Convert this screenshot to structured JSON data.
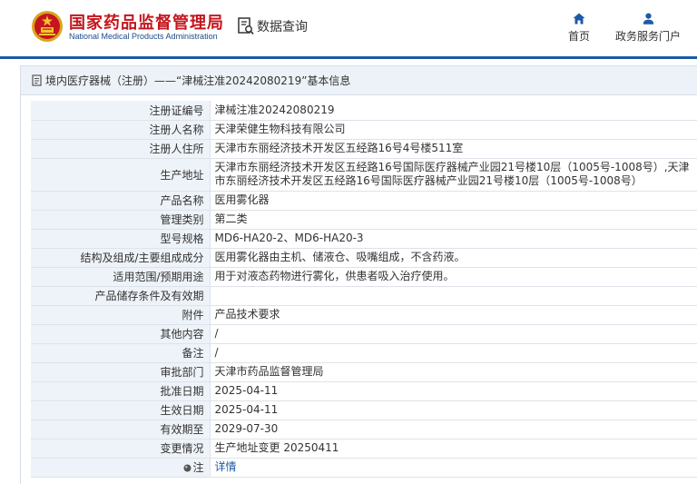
{
  "header": {
    "brand_cn": "国家药品监督管理局",
    "brand_en": "National Medical Products Administration",
    "query_label": "数据查询",
    "nav_home": "首页",
    "nav_service": "政务服务门户"
  },
  "colors": {
    "brand_red": "#c4161c",
    "brand_blue": "#1d5aa6",
    "label_bg": "#eef3f9"
  },
  "panel": {
    "title": "境内医疗器械（注册）——“津械注准20242080219”基本信息"
  },
  "rows": [
    {
      "label": "注册证编号",
      "value": "津械注准20242080219"
    },
    {
      "label": "注册人名称",
      "value": "天津荣健生物科技有限公司"
    },
    {
      "label": "注册人住所",
      "value": "天津市东丽经济技术开发区五经路16号4号楼511室"
    },
    {
      "label": "生产地址",
      "value": "天津市东丽经济技术开发区五经路16号国际医疗器械产业园21号楼10层（1005号-1008号）,天津市东丽经济技术开发区五经路16号国际医疗器械产业园21号楼10层（1005号-1008号）"
    },
    {
      "label": "产品名称",
      "value": "医用雾化器"
    },
    {
      "label": "管理类别",
      "value": "第二类"
    },
    {
      "label": "型号规格",
      "value": "MD6-HA20-2、MD6-HA20-3"
    },
    {
      "label": "结构及组成/主要组成成分",
      "value": "医用雾化器由主机、储液仓、吸嘴组成，不含药液。"
    },
    {
      "label": "适用范围/预期用途",
      "value": "用于对液态药物进行雾化，供患者吸入治疗使用。"
    },
    {
      "label": "产品储存条件及有效期",
      "value": ""
    },
    {
      "label": "附件",
      "value": "产品技术要求"
    },
    {
      "label": "其他内容",
      "value": "/"
    },
    {
      "label": "备注",
      "value": "/"
    },
    {
      "label": "审批部门",
      "value": "天津市药品监督管理局"
    },
    {
      "label": "批准日期",
      "value": "2025-04-11"
    },
    {
      "label": "生效日期",
      "value": "2025-04-11"
    },
    {
      "label": "有效期至",
      "value": "2029-07-30"
    },
    {
      "label": "变更情况",
      "value": "生产地址变更 20250411"
    },
    {
      "label": "注",
      "value": "详情"
    }
  ]
}
